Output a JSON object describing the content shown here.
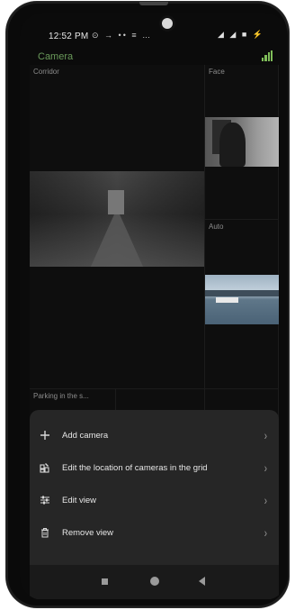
{
  "status_bar": {
    "time": "12:52 PM",
    "left_icons": "⊙ → •• ≡ …",
    "right_icons": "◢ ◢ ■ ⚡"
  },
  "app": {
    "title": "Camera",
    "accent": "#7fbd59"
  },
  "grid": {
    "cells": [
      {
        "label": "Corridor"
      },
      {
        "label": "Face"
      },
      {
        "label": "Auto"
      },
      {
        "label": "Parking in the s..."
      }
    ]
  },
  "menu": {
    "items": [
      {
        "label": "Add camera",
        "icon": "plus-icon"
      },
      {
        "label": "Edit the location of cameras in the grid",
        "icon": "grid-edit-icon"
      },
      {
        "label": "Edit view",
        "icon": "sliders-icon"
      },
      {
        "label": "Remove view",
        "icon": "trash-icon"
      }
    ]
  },
  "nav": {
    "square": "recents",
    "circle": "home",
    "triangle": "back"
  }
}
